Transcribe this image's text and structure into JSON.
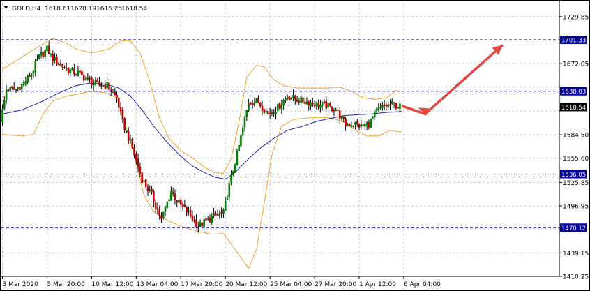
{
  "header": {
    "symbol": "GOLD,H4",
    "open": "1618.61",
    "high": "1620.19",
    "low": "1616.25",
    "close": "1618.54",
    "menu_icon": "triangle-down-icon"
  },
  "colors": {
    "background": "#ffffff",
    "grid": "#c8c8c8",
    "bull": "#008000",
    "bear": "#c00000",
    "bollinger": "#f5a030",
    "moving_average": "#1f1fb4",
    "level_line": "#0000a0",
    "level_tag": "#0000a0",
    "price_tag": "#000000",
    "arrow": "#e04840"
  },
  "chart_data": {
    "type": "candlestick",
    "title": "GOLD,H4",
    "ylim": [
      1410.25,
      1746
    ],
    "y_ticks": [
      1729.85,
      1701.1,
      1672.05,
      1643.3,
      1613.9,
      1584.5,
      1555.6,
      1525.85,
      1496.95,
      1468.65,
      1439.15,
      1410.25
    ],
    "y_tick_labels": [
      "1729.85",
      "",
      "1672.05",
      "",
      "",
      "1584.50",
      "1555.60",
      "1525.85",
      "1496.95",
      "",
      "1439.15",
      "1410.25"
    ],
    "x_ticks": [
      "3 Mar 2020",
      "5 Mar 20:00",
      "10 Mar 12:00",
      "13 Mar 04:00",
      "17 Mar 20:00",
      "20 Mar 12:00",
      "25 Mar 04:00",
      "27 Mar 20:00",
      "1 Apr 12:00",
      "6 Apr 04:00"
    ],
    "x_tick_index": [
      0,
      23,
      46,
      69,
      92,
      115,
      138,
      161,
      184,
      207
    ],
    "levels": [
      {
        "value": 1701.33,
        "label": "1701.33"
      },
      {
        "value": 1638.03,
        "label": "1638.03"
      },
      {
        "value": 1536.05,
        "label": "1536.05"
      },
      {
        "value": 1470.12,
        "label": "1470.12"
      }
    ],
    "current_price": {
      "value": 1618.54,
      "label": "1618.54"
    },
    "close_anchors": [
      [
        0,
        1600
      ],
      [
        3,
        1640
      ],
      [
        8,
        1640
      ],
      [
        12,
        1648
      ],
      [
        16,
        1660
      ],
      [
        20,
        1680
      ],
      [
        24,
        1690
      ],
      [
        27,
        1678
      ],
      [
        30,
        1672
      ],
      [
        35,
        1664
      ],
      [
        40,
        1660
      ],
      [
        45,
        1652
      ],
      [
        50,
        1646
      ],
      [
        55,
        1645
      ],
      [
        60,
        1630
      ],
      [
        63,
        1600
      ],
      [
        68,
        1568
      ],
      [
        73,
        1530
      ],
      [
        78,
        1510
      ],
      [
        83,
        1480
      ],
      [
        88,
        1515
      ],
      [
        92,
        1500
      ],
      [
        97,
        1488
      ],
      [
        102,
        1472
      ],
      [
        106,
        1478
      ],
      [
        110,
        1484
      ],
      [
        115,
        1488
      ],
      [
        118,
        1522
      ],
      [
        122,
        1560
      ],
      [
        125,
        1592
      ],
      [
        128,
        1625
      ],
      [
        133,
        1625
      ],
      [
        138,
        1610
      ],
      [
        143,
        1618
      ],
      [
        148,
        1632
      ],
      [
        153,
        1628
      ],
      [
        158,
        1625
      ],
      [
        163,
        1622
      ],
      [
        168,
        1620
      ],
      [
        173,
        1616
      ],
      [
        178,
        1597
      ],
      [
        182,
        1598
      ],
      [
        186,
        1595
      ],
      [
        190,
        1598
      ],
      [
        194,
        1613
      ],
      [
        198,
        1620
      ],
      [
        203,
        1622
      ],
      [
        205,
        1619
      ]
    ],
    "bb_upper_anchors": [
      [
        0,
        1665
      ],
      [
        10,
        1680
      ],
      [
        20,
        1695
      ],
      [
        26,
        1703
      ],
      [
        33,
        1697
      ],
      [
        38,
        1690
      ],
      [
        46,
        1685
      ],
      [
        55,
        1690
      ],
      [
        61,
        1700
      ],
      [
        66,
        1700
      ],
      [
        71,
        1685
      ],
      [
        76,
        1650
      ],
      [
        81,
        1605
      ],
      [
        86,
        1580
      ],
      [
        92,
        1565
      ],
      [
        98,
        1556
      ],
      [
        104,
        1545
      ],
      [
        109,
        1538
      ],
      [
        114,
        1537
      ],
      [
        118,
        1555
      ],
      [
        122,
        1600
      ],
      [
        126,
        1655
      ],
      [
        131,
        1670
      ],
      [
        135,
        1668
      ],
      [
        140,
        1652
      ],
      [
        145,
        1645
      ],
      [
        152,
        1642
      ],
      [
        160,
        1642
      ],
      [
        168,
        1642
      ],
      [
        174,
        1643
      ],
      [
        180,
        1638
      ],
      [
        186,
        1630
      ],
      [
        192,
        1628
      ],
      [
        198,
        1630
      ],
      [
        203,
        1639
      ],
      [
        205,
        1638
      ]
    ],
    "bb_lower_anchors": [
      [
        0,
        1585
      ],
      [
        10,
        1583
      ],
      [
        16,
        1585
      ],
      [
        21,
        1610
      ],
      [
        26,
        1626
      ],
      [
        33,
        1632
      ],
      [
        40,
        1635
      ],
      [
        46,
        1638
      ],
      [
        53,
        1636
      ],
      [
        59,
        1630
      ],
      [
        63,
        1600
      ],
      [
        68,
        1560
      ],
      [
        73,
        1510
      ],
      [
        78,
        1490
      ],
      [
        86,
        1478
      ],
      [
        94,
        1470
      ],
      [
        102,
        1465
      ],
      [
        108,
        1462
      ],
      [
        114,
        1463
      ],
      [
        118,
        1450
      ],
      [
        122,
        1437
      ],
      [
        127,
        1420
      ],
      [
        131,
        1443
      ],
      [
        135,
        1500
      ],
      [
        139,
        1560
      ],
      [
        144,
        1595
      ],
      [
        150,
        1603
      ],
      [
        156,
        1605
      ],
      [
        164,
        1606
      ],
      [
        170,
        1605
      ],
      [
        176,
        1600
      ],
      [
        182,
        1590
      ],
      [
        188,
        1583
      ],
      [
        194,
        1583
      ],
      [
        200,
        1590
      ],
      [
        205,
        1588
      ]
    ],
    "ma_anchors": [
      [
        0,
        1610
      ],
      [
        10,
        1615
      ],
      [
        20,
        1625
      ],
      [
        30,
        1637
      ],
      [
        38,
        1645
      ],
      [
        45,
        1648
      ],
      [
        53,
        1647
      ],
      [
        60,
        1642
      ],
      [
        66,
        1632
      ],
      [
        72,
        1615
      ],
      [
        78,
        1595
      ],
      [
        85,
        1575
      ],
      [
        92,
        1558
      ],
      [
        98,
        1546
      ],
      [
        104,
        1538
      ],
      [
        110,
        1532
      ],
      [
        115,
        1530
      ],
      [
        120,
        1538
      ],
      [
        127,
        1555
      ],
      [
        133,
        1568
      ],
      [
        140,
        1580
      ],
      [
        147,
        1590
      ],
      [
        155,
        1595
      ],
      [
        162,
        1601
      ],
      [
        170,
        1605
      ],
      [
        176,
        1608
      ],
      [
        182,
        1609
      ],
      [
        190,
        1610
      ],
      [
        198,
        1612
      ],
      [
        205,
        1613
      ]
    ],
    "bar_count": 206,
    "projection_arrow": {
      "points": [
        [
          206,
          1620
        ],
        [
          218,
          1610
        ],
        [
          258,
          1695
        ]
      ]
    }
  }
}
